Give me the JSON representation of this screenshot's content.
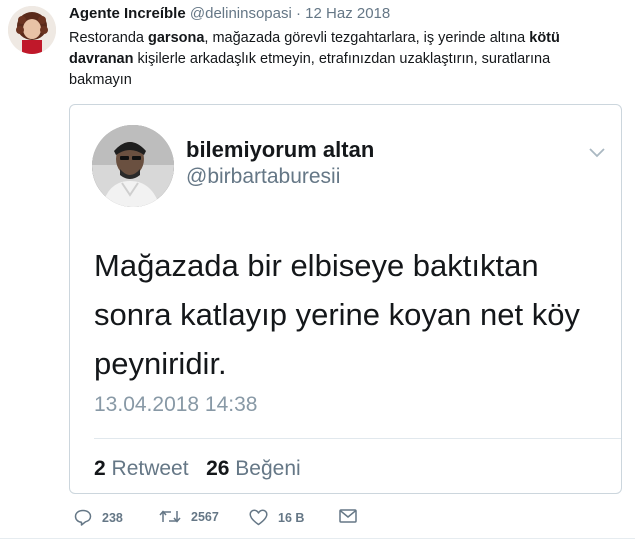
{
  "tweet": {
    "author_name": "Agente Increíble",
    "author_handle": "@delininsopasi",
    "separator": "·",
    "date": "12 Haz 2018",
    "text_parts": {
      "p1": "Restoranda ",
      "b1": "garsona",
      "p2": ", mağazada görevli tezgahtarlara, iş yerinde altına ",
      "b2": "kötü davranan",
      "p3": " kişilerle arkadaşlık etmeyin, etrafınızdan uzaklaştırın, suratlarına bakmayın"
    },
    "actions": {
      "replies": "238",
      "retweets": "2567",
      "likes": "16 B"
    }
  },
  "quoted": {
    "name": "bilemiyorum altan",
    "handle": "@birbartaburesii",
    "text": "Mağazada bir elbiseye baktıktan sonra katlayıp yerine koyan net köy peyniridir.",
    "timestamp": "13.04.2018 14:38",
    "retweet_count": "2",
    "retweet_label": "Retweet",
    "like_count": "26",
    "like_label": "Beğeni"
  },
  "icons": {
    "reply": "reply-icon",
    "retweet": "retweet-icon",
    "like": "heart-icon",
    "dm": "envelope-icon",
    "more": "chevron-down-icon"
  },
  "colors": {
    "text": "#14171a",
    "muted": "#657786",
    "border": "#ccd6dd"
  }
}
